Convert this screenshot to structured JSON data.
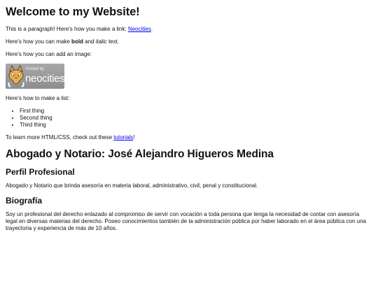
{
  "heading": "Welcome to my Website!",
  "intro": {
    "before": "This is a paragraph! Here's how you make a link: ",
    "link": "Neocities",
    "after": "."
  },
  "format": {
    "before": "Here's how you can make ",
    "bold": "bold",
    "middle": " and ",
    "italic": "italic",
    "after": " text."
  },
  "image_text": "Here's how you can add an image:",
  "badge": {
    "hosted": "hosted by",
    "brand": "neocities",
    "icon": "neocities-cat-icon",
    "bg_color": "#9a9a9a"
  },
  "list_intro": "Here's how to make a list:",
  "list": [
    "First thing",
    "Second thing",
    "Third thing"
  ],
  "learn": {
    "before": "To learn more HTML/CSS, check out these ",
    "link": "tutorials",
    "after": "!"
  },
  "profile": {
    "title": "Abogado y Notario: José Alejandro Higueros Medina",
    "section1_heading": "Perfil Profesional",
    "section1_text": "Abogado y Notario que brinda asesoría en materia laboral, administrativo, civil, penal y constitucional.",
    "section2_heading": "Biografía",
    "section2_text": "Soy un profesional del derecho enlazado al compromiso de servir con vocación a toda persona que tenga la necesidad de contar con asesoría legal en diversas materias del derecho. Poseo conocimientos también de la administración pública por haber laborado en el área pública con una trayectoria y experiencia de más de 10 años."
  },
  "colors": {
    "link": "#0000ee",
    "text": "#111111",
    "background": "#ffffff"
  }
}
